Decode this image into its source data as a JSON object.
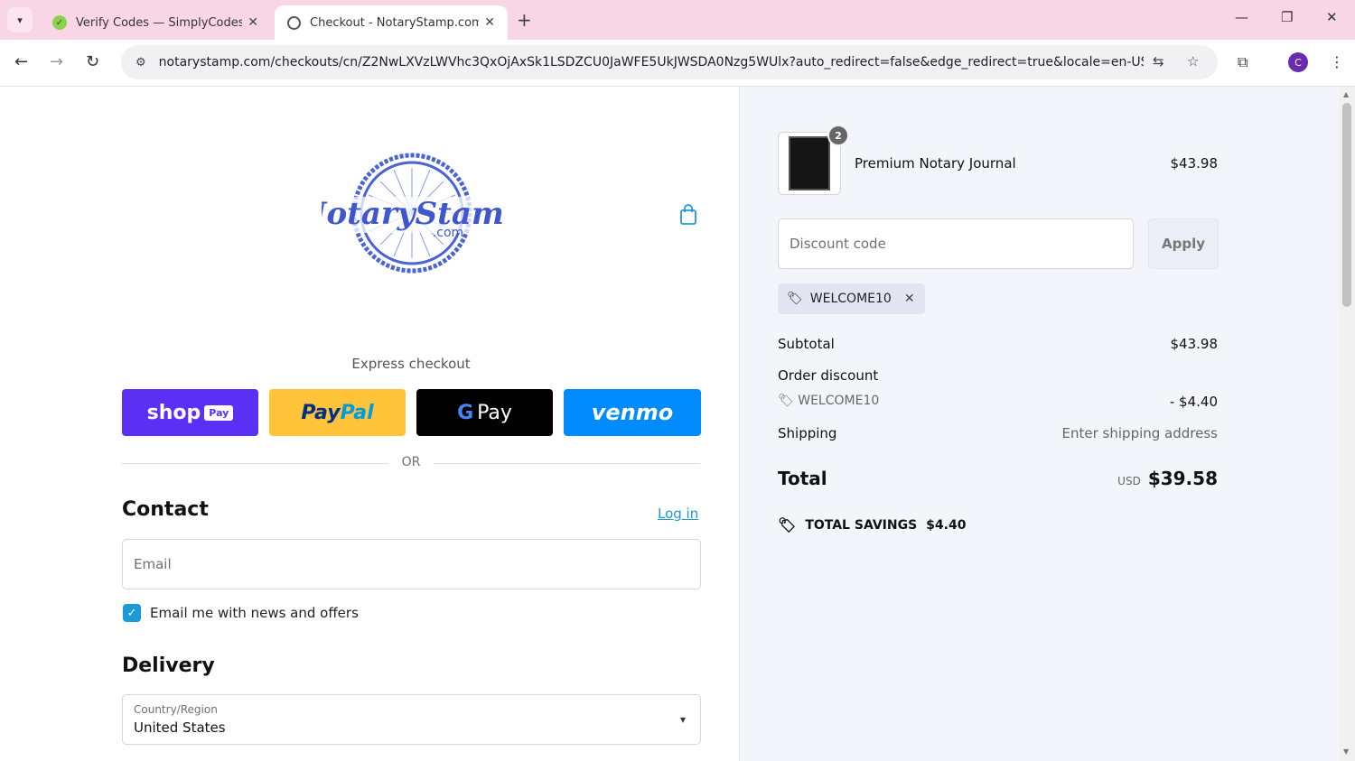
{
  "browser": {
    "tabs": [
      {
        "title": "Verify Codes — SimplyCodes",
        "active": false
      },
      {
        "title": "Checkout - NotaryStamp.com",
        "active": true
      }
    ],
    "url": "notarystamp.com/checkouts/cn/Z2NwLXVzLWVhc3QxOjAxSk1LSDZCU0JaWFE5UkJWSDA0Nzg5WUlx?auto_redirect=false&edge_redirect=true&locale=en-US&...",
    "profile_initial": "C"
  },
  "checkout": {
    "logo_alt": "NotaryStamp.com",
    "express_label": "Express checkout",
    "express": {
      "shop": "shop",
      "shop_pay": "Pay",
      "paypal_a": "Pay",
      "paypal_b": "Pal",
      "gpay": "Pay",
      "venmo": "venmo"
    },
    "or": "OR",
    "contact_title": "Contact",
    "login": "Log in",
    "email_placeholder": "Email",
    "newsletter_label": "Email me with news and offers",
    "delivery_title": "Delivery",
    "country_label": "Country/Region",
    "country_value": "United States"
  },
  "summary": {
    "product": {
      "name": "Premium Notary Journal",
      "price": "$43.98",
      "quantity": "2"
    },
    "discount_placeholder": "Discount code",
    "apply": "Apply",
    "applied_code": "WELCOME10",
    "subtotal_label": "Subtotal",
    "subtotal": "$43.98",
    "order_discount_label": "Order discount",
    "discount_code": "WELCOME10",
    "discount_amount": "- $4.40",
    "shipping_label": "Shipping",
    "shipping_value": "Enter shipping address",
    "total_label": "Total",
    "currency": "USD",
    "total": "$39.58",
    "savings_label": "TOTAL SAVINGS",
    "savings_amount": "$4.40"
  }
}
